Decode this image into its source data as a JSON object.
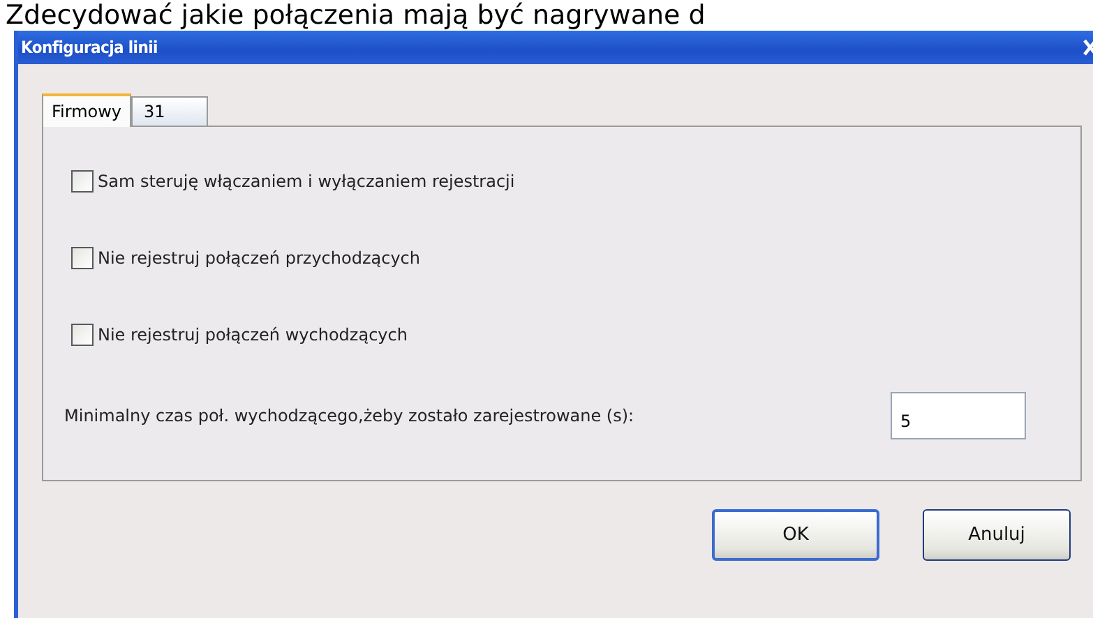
{
  "caption": "Zdecydować jakie połączenia mają być nagrywane d",
  "window": {
    "title": "Konfiguracja linii"
  },
  "tabs": [
    {
      "label": "Firmowy",
      "selected": true
    },
    {
      "label": "31",
      "selected": false
    }
  ],
  "options": [
    {
      "label": "Sam steruję włączaniem i wyłączaniem rejestracji",
      "checked": false
    },
    {
      "label": "Nie rejestruj połączeń przychodzących",
      "checked": false
    },
    {
      "label": "Nie rejestruj połączeń wychodzących",
      "checked": false
    }
  ],
  "min_time": {
    "label": "Minimalny czas poł. wychodzącego,żeby zostało zarejestrowane (s):",
    "value": "5"
  },
  "buttons": [
    "OK",
    "Anuluj"
  ]
}
